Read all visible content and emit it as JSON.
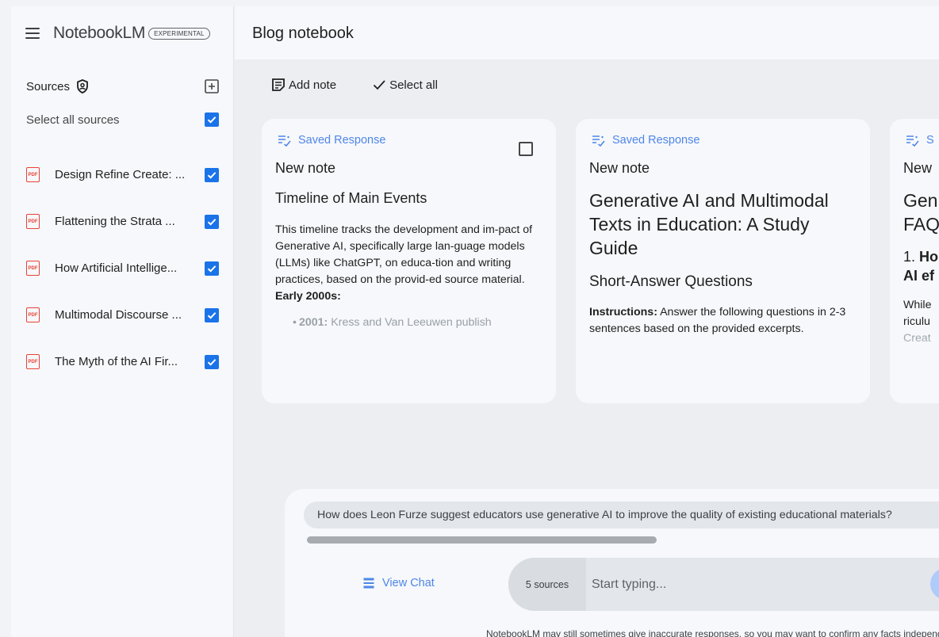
{
  "app": {
    "name": "NotebookLM",
    "badge": "EXPERIMENTAL",
    "notebook_title": "Blog notebook"
  },
  "sidebar": {
    "sources_label": "Sources",
    "select_all_label": "Select all sources",
    "items": [
      {
        "name": "Design Refine Create: ...",
        "checked": true
      },
      {
        "name": "Flattening the Strata ...",
        "checked": true
      },
      {
        "name": "How Artificial Intellige...",
        "checked": true
      },
      {
        "name": "Multimodal Discourse ...",
        "checked": true
      },
      {
        "name": "The Myth of the AI Fir...",
        "checked": true
      }
    ],
    "pdf_label": "PDF"
  },
  "toolbar": {
    "add_note_label": "Add note",
    "select_all_label": "Select all"
  },
  "cards": [
    {
      "tag": "Saved Response",
      "note_label": "New note",
      "heading": "Timeline of Main Events",
      "body": "This timeline tracks the development and im-pact of Generative AI, specifically large lan-guage models (LLMs) like ChatGPT, on educa-tion and writing practices, based on the provid-ed source material.",
      "section": "Early 2000s:",
      "bullet_year": "2001:",
      "bullet_text": "Kress and Van Leeuwen publish"
    },
    {
      "tag": "Saved Response",
      "note_label": "New note",
      "heading": "Generative AI and Multimodal Texts in Education: A Study Guide",
      "subheading": "Short-Answer Questions",
      "instr_bold": "Instructions:",
      "instr_text": "Answer the following questions in 2-3 sentences based on the provided excerpts."
    },
    {
      "tag": "S",
      "note_label": "New",
      "heading_line1": "Gen",
      "heading_line2": "FAQ",
      "q_num": "1.",
      "q_bold1": "Ho",
      "q_bold2": "AI ef",
      "body_line1": "While",
      "body_line2": "riculu",
      "body_line3": "Creat"
    }
  ],
  "chat": {
    "suggestion": "How does Leon Furze suggest educators use generative AI to improve the quality of existing educational materials?",
    "view_chat_label": "View Chat",
    "sources_count": "5 sources",
    "input_placeholder": "Start typing...",
    "disclaimer": "NotebookLM may still sometimes give inaccurate responses, so you may want to confirm any facts independently."
  },
  "colors": {
    "accent": "#1a73e8",
    "tag_blue": "#4f86e8",
    "pdf_red": "#e94235"
  }
}
